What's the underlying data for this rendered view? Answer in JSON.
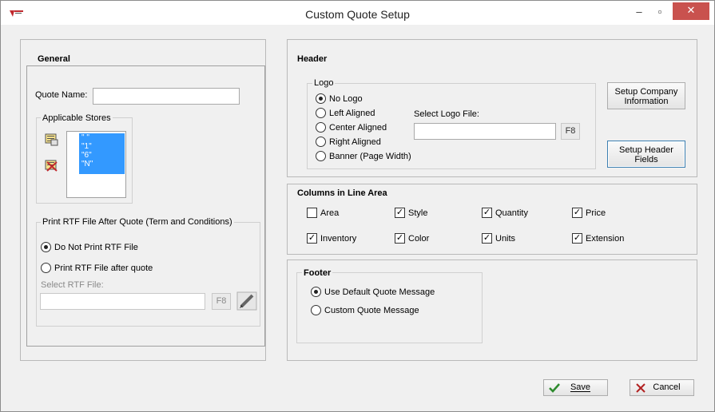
{
  "window": {
    "title": "Custom Quote Setup",
    "minimize_glyph": "–",
    "maximize_glyph": "▫",
    "close_glyph": "✕"
  },
  "general": {
    "title": "General",
    "quote_name_label": "Quote Name:",
    "quote_name_value": "",
    "applicable_stores_label": "Applicable Stores",
    "stores": [
      "\" \"",
      "\"1\"",
      "\"6\"",
      "\"N\""
    ],
    "print_rtf_title": "Print RTF File After Quote (Term and Conditions)",
    "do_not_print_label": "Do Not Print RTF File",
    "print_after_label": "Print RTF File after quote",
    "select_rtf_label": "Select RTF File:",
    "rtf_file_value": "",
    "f8_label": "F8"
  },
  "header": {
    "title": "Header",
    "logo_title": "Logo",
    "logo_options": [
      "No Logo",
      "Left Aligned",
      "Center Aligned",
      "Right Aligned",
      "Banner (Page Width)"
    ],
    "logo_selected_index": 0,
    "select_logo_label": "Select Logo File:",
    "logo_file_value": "",
    "f8_label": "F8",
    "setup_company_label_1": "Setup Company",
    "setup_company_label_2": "Information",
    "setup_header_label_1": "Setup Header",
    "setup_header_label_2": "Fields"
  },
  "columns": {
    "title": "Columns in Line Area",
    "items": [
      {
        "label": "Area",
        "checked": false
      },
      {
        "label": "Style",
        "checked": true
      },
      {
        "label": "Quantity",
        "checked": true
      },
      {
        "label": "Price",
        "checked": true
      },
      {
        "label": "Inventory",
        "checked": true
      },
      {
        "label": "Color",
        "checked": true
      },
      {
        "label": "Units",
        "checked": true
      },
      {
        "label": "Extension",
        "checked": true
      }
    ]
  },
  "footer": {
    "title": "Footer",
    "use_default_label": "Use Default Quote Message",
    "custom_label": "Custom Quote Message"
  },
  "actions": {
    "save_label": "Save",
    "cancel_label": "Cancel"
  },
  "icons": {
    "app_logo": "app-logo-icon",
    "add_store": "add-store-icon",
    "remove_store": "remove-store-icon",
    "edit_rtf": "edit-pencil-icon",
    "save": "checkmark-icon",
    "cancel": "x-mark-icon"
  },
  "colors": {
    "selection": "#3399ff",
    "close_button": "#c9524e",
    "save_check": "#2e8b2e",
    "cancel_x": "#b22222"
  }
}
